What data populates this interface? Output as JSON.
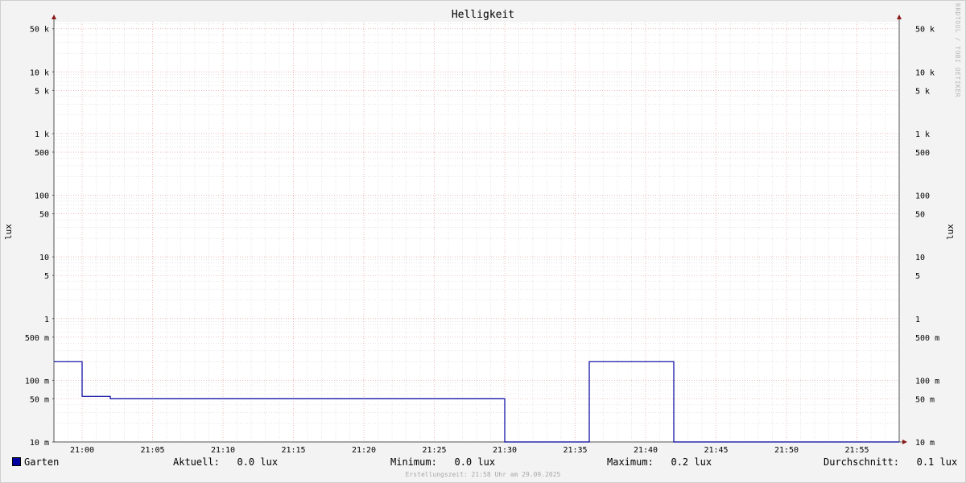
{
  "chart_data": {
    "type": "line",
    "title": "Helligkeit",
    "ylabel": "lux",
    "yscale": "log",
    "ylim": [
      10,
      50000
    ],
    "y_ticks": [
      {
        "value": 50000,
        "label": "50 k"
      },
      {
        "value": 10000,
        "label": "10 k"
      },
      {
        "value": 5000,
        "label": "5 k"
      },
      {
        "value": 1000,
        "label": "1 k"
      },
      {
        "value": 500,
        "label": "500"
      },
      {
        "value": 100,
        "label": "100"
      },
      {
        "value": 50,
        "label": "50"
      },
      {
        "value": 10,
        "label": "10"
      },
      {
        "value": 5,
        "label": "5"
      },
      {
        "value": 1,
        "label": "1"
      },
      {
        "value": 0.5,
        "label": "500 m"
      },
      {
        "value": 0.1,
        "label": "100 m"
      },
      {
        "value": 0.05,
        "label": "50 m"
      },
      {
        "value": 0.01,
        "label": "10 m"
      }
    ],
    "x_ticks": [
      "21:00",
      "21:05",
      "21:10",
      "21:15",
      "21:20",
      "21:25",
      "21:30",
      "21:35",
      "21:40",
      "21:45",
      "21:50",
      "21:55"
    ],
    "xlim": [
      "20:58",
      "21:58"
    ],
    "grid": true,
    "series": [
      {
        "name": "Garten",
        "color": "#0000a0",
        "points": [
          [
            "20:58",
            0.2
          ],
          [
            "21:00",
            0.2
          ],
          [
            "21:00",
            0.055
          ],
          [
            "21:02",
            0.055
          ],
          [
            "21:02",
            0.05
          ],
          [
            "21:30",
            0.05
          ],
          [
            "21:30",
            0.01
          ],
          [
            "21:36",
            0.01
          ],
          [
            "21:36",
            0.2
          ],
          [
            "21:42",
            0.2
          ],
          [
            "21:42",
            0.01
          ],
          [
            "21:58",
            0.01
          ]
        ]
      }
    ]
  },
  "legend": {
    "series_name": "Garten",
    "aktuell_label": "Aktuell:",
    "aktuell_value": "0.0 lux",
    "minimum_label": "Minimum:",
    "minimum_value": "0.0 lux",
    "maximum_label": "Maximum:",
    "maximum_value": "0.2 lux",
    "durchschnitt_label": "Durchschnitt:",
    "durchschnitt_value": "0.1 lux"
  },
  "watermark": "RRDTOOL / TOBI OETIKER",
  "footer": "Erstellungszeit: 21:58 Uhr am 29.09.2025"
}
